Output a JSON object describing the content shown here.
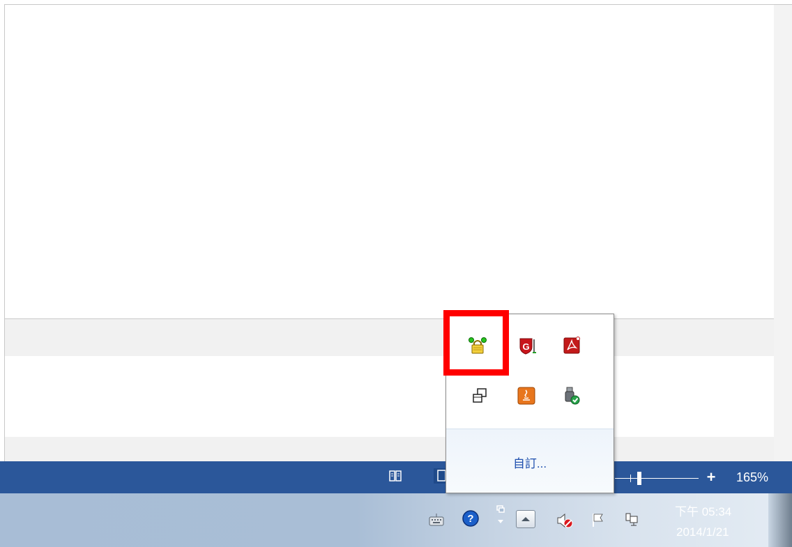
{
  "statusbar": {
    "zoom_level": "165%",
    "icons": [
      "read-mode-icon",
      "print-layout-icon",
      "zoom-plus-icon"
    ],
    "background_color": "#2b579a"
  },
  "overflow_popup": {
    "icons": [
      "vpn-lock-icon",
      "g-data-shield-icon",
      "adobe-acrobat-icon",
      "display-switch-icon",
      "java-update-icon",
      "usb-safe-remove-icon"
    ],
    "customize_label": "自訂..."
  },
  "taskbar": {
    "tray_icons": [
      "keyboard-icon",
      "help-icon",
      "language-bar-icon",
      "show-hidden-icons-button",
      "volume-muted-icon",
      "action-center-flag-icon",
      "network-icon"
    ],
    "clock": {
      "time": "下午 05:34",
      "date": "2014/1/21"
    }
  },
  "highlight": {
    "color": "#ff0000",
    "target": "vpn-lock-icon"
  }
}
